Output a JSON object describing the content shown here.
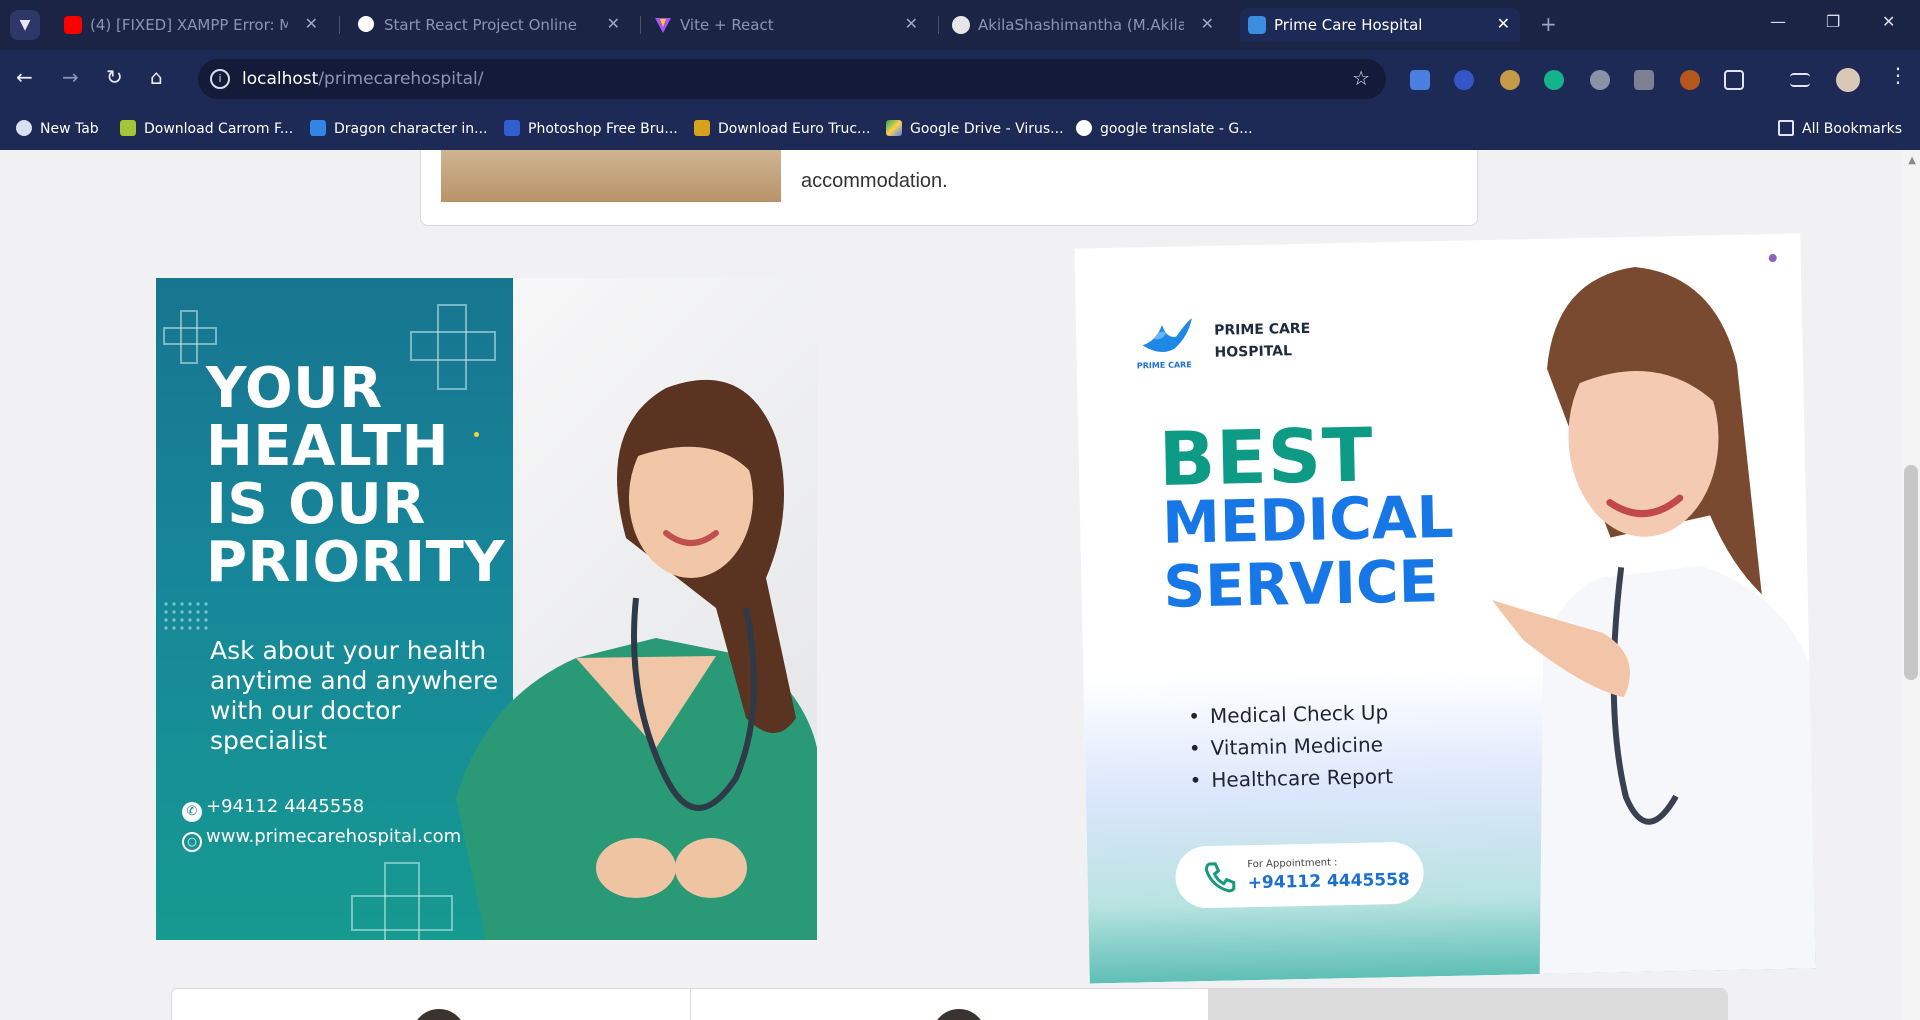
{
  "browser": {
    "tabs": [
      {
        "title": "(4) [FIXED] XAMPP Error: MySQL",
        "icon": "youtube-icon",
        "active": false
      },
      {
        "title": "Start React Project Online",
        "icon": "openai-icon",
        "active": false
      },
      {
        "title": "Vite + React",
        "icon": "vite-icon",
        "active": false
      },
      {
        "title": "AkilaShashimantha (M.Akila Sha",
        "icon": "github-icon",
        "active": false
      },
      {
        "title": "Prime Care Hospital",
        "icon": "hospital-icon",
        "active": true
      }
    ],
    "url_host": "localhost",
    "url_path": "/primecarehospital/",
    "bookmarks": [
      {
        "label": "New Tab",
        "icon": "globe-icon"
      },
      {
        "label": "Download Carrom F...",
        "icon": "android-icon"
      },
      {
        "label": "Dragon character in...",
        "icon": "dragon-icon"
      },
      {
        "label": "Photoshop Free Bru...",
        "icon": "brush-icon"
      },
      {
        "label": "Download Euro Truc...",
        "icon": "truck-icon"
      },
      {
        "label": "Google Drive - Virus...",
        "icon": "drive-icon"
      },
      {
        "label": "google translate - G...",
        "icon": "google-icon"
      }
    ],
    "all_bookmarks": "All Bookmarks"
  },
  "page": {
    "room_card_text": "accommodation.",
    "left_banner": {
      "headline": [
        "YOUR",
        "HEALTH",
        "IS OUR",
        "PRIORITY"
      ],
      "subtext": "Ask about your health anytime and anywhere with our doctor specialist",
      "phone": "+94112 4445558",
      "website": "www.primecarehospital.com"
    },
    "right_banner": {
      "logo_caption": "PRIME CARE",
      "hospital_name_line1": "PRIME CARE",
      "hospital_name_line2": "HOSPITAL",
      "best": "BEST",
      "medical": "MEDICAL",
      "service": "SERVICE",
      "services": [
        "Medical Check Up",
        "Vitamin Medicine",
        "Healthcare Report"
      ],
      "appointment_label": "For Appointment :",
      "appointment_phone": "+94112 4445558"
    }
  },
  "colors": {
    "chrome_bg": "#1d2a55",
    "teal": "#168e98",
    "green_heading": "#0e9b86",
    "blue_heading": "#1777e6"
  }
}
